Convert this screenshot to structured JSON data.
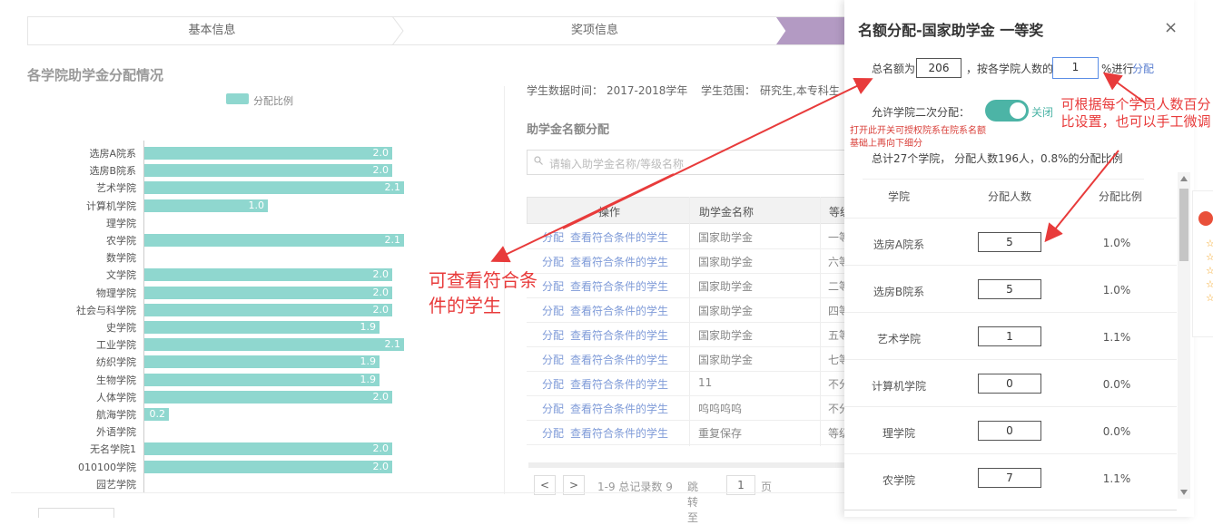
{
  "steps": [
    "基本信息",
    "奖项信息"
  ],
  "chart": {
    "title": "各学院助学金分配情况",
    "legend": "分配比例"
  },
  "chart_data": {
    "type": "bar",
    "orientation": "horizontal",
    "title": "各学院助学金分配情况",
    "series_name": "分配比例",
    "xlim": [
      0,
      2.2
    ],
    "categories": [
      "选房A院系",
      "选房B院系",
      "艺术学院",
      "计算机学院",
      "理学院",
      "农学院",
      "数学院",
      "文学院",
      "物理学院",
      "社会与科学院",
      "史学院",
      "工业学院",
      "纺织学院",
      "生物学院",
      "人体学院",
      "航海学院",
      "外语学院",
      "无名学院1",
      "010100学院",
      "园艺学院"
    ],
    "values": [
      2.0,
      2.0,
      2.1,
      1.0,
      0,
      2.1,
      0,
      2.0,
      2.0,
      2.0,
      1.9,
      2.1,
      1.9,
      1.9,
      2.0,
      0.2,
      0,
      2.0,
      2.0,
      0
    ],
    "labels": [
      "2.0",
      "2.0",
      "2.1",
      "1.0",
      "",
      "2.1",
      "",
      "2.0",
      "2.0",
      "2.0",
      "1.9",
      "2.1",
      "1.9",
      "1.9",
      "2.0",
      "0.2",
      "",
      "2.0",
      "2.0",
      ""
    ]
  },
  "info": {
    "time_label": "学生数据时间：",
    "time_value": "2017-2018学年",
    "scope_label": "学生范围：",
    "scope_value": "研究生,本专科生"
  },
  "section_title": "助学金名额分配",
  "search_placeholder": "请输入助学金名称/等级名称",
  "table": {
    "headers": [
      "操作",
      "助学金名称",
      "等级"
    ],
    "action1": "分配",
    "action2": "查看符合条件的学生",
    "rows": [
      {
        "name": "国家助学金",
        "level": "一等"
      },
      {
        "name": "国家助学金",
        "level": "六等"
      },
      {
        "name": "国家助学金",
        "level": "二等"
      },
      {
        "name": "国家助学金",
        "level": "四等"
      },
      {
        "name": "国家助学金",
        "level": "五等"
      },
      {
        "name": "国家助学金",
        "level": "七等"
      },
      {
        "name": "11",
        "level": "不分"
      },
      {
        "name": "呜呜呜呜",
        "level": "不分"
      },
      {
        "name": "重复保存",
        "level": "等级"
      }
    ]
  },
  "pager": {
    "prev": "<",
    "next": ">",
    "summary": "1-9 总记录数 9",
    "jump_label": "跳转至",
    "page": "1",
    "page_unit": "页"
  },
  "modal": {
    "title": "名额分配-国家助学金 一等奖",
    "close": "×",
    "total_prefix": "总名额为",
    "total_value": "206",
    "total_mid": "，按各学院人数的",
    "percent_value": "1",
    "total_suffix": "%进行",
    "assign_link": "分配",
    "allow_label": "允许学院二次分配：",
    "toggle_label": "关闭",
    "hint": "打开此开关可授权院系在院系名额基础上再向下细分",
    "summary": "总计27个学院， 分配人数196人，0.8%的分配比例",
    "headers": [
      "学院",
      "分配人数",
      "分配比例"
    ],
    "rows": [
      {
        "college": "选房A院系",
        "count": "5",
        "ratio": "1.0%"
      },
      {
        "college": "选房B院系",
        "count": "5",
        "ratio": "1.0%"
      },
      {
        "college": "艺术学院",
        "count": "1",
        "ratio": "1.1%"
      },
      {
        "college": "计算机学院",
        "count": "0",
        "ratio": "0.0%"
      },
      {
        "college": "理学院",
        "count": "0",
        "ratio": "0.0%"
      },
      {
        "college": "农学院",
        "count": "7",
        "ratio": "1.1%"
      }
    ]
  },
  "annotations": {
    "left": "可查看符合条件的学生",
    "right": "可根据每个学员人数百分比设置，也可以手工微调"
  },
  "colors": {
    "bar": "#8fd7cf",
    "toggle": "#4cb4a6",
    "link": "#7f9bd8",
    "annotation": "#e83b3b",
    "step_active": "#b39ac3"
  }
}
